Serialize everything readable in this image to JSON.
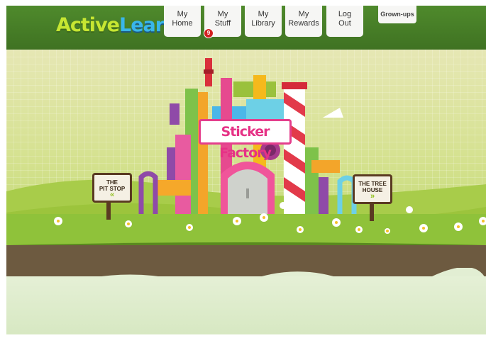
{
  "logo": {
    "part1": "Active",
    "part2": "Learn"
  },
  "nav": {
    "home": [
      "My",
      "Home"
    ],
    "stuff": [
      "My",
      "Stuff"
    ],
    "library": [
      "My",
      "Library"
    ],
    "rewards": [
      "My",
      "Rewards"
    ],
    "logout": [
      "Log",
      "Out"
    ],
    "grownups": "Grown-ups",
    "stuff_badge": "9"
  },
  "scene": {
    "factory_title": "Sticker Factory",
    "sign_left": {
      "line1": "THE",
      "line2": "PIT STOP",
      "arrow": "«"
    },
    "sign_right": {
      "line1": "THE TREE",
      "line2": "HOUSE",
      "arrow": "»"
    }
  },
  "colors": {
    "header": "#4a8229",
    "badge": "#d22020",
    "factory_pink": "#e43e8c"
  }
}
